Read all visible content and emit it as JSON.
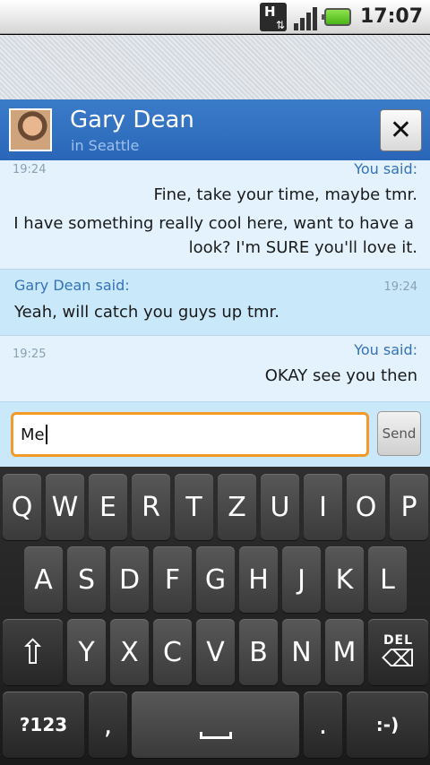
{
  "status_bar": {
    "network_type": "H",
    "network_arrows": "⇅",
    "time": "17:07"
  },
  "header": {
    "contact_name": "Gary Dean",
    "location": "in Seattle",
    "close_glyph": "✕"
  },
  "messages": [
    {
      "time": "19:24",
      "sender": "You said:",
      "lines": [
        "Fine, take your time, maybe tmr.",
        "I have something really cool here, want to have a",
        "look? I'm SURE you'll love it."
      ]
    },
    {
      "time": "19:24",
      "sender": "Gary Dean said:",
      "lines": [
        "Yeah, will catch you guys up tmr."
      ]
    },
    {
      "time": "19:25",
      "sender": "You said:",
      "lines": [
        "OKAY see you then"
      ]
    }
  ],
  "compose": {
    "input_value": "Me",
    "send_label": "Send"
  },
  "keyboard": {
    "row1": [
      "Q",
      "W",
      "E",
      "R",
      "T",
      "Z",
      "U",
      "I",
      "O",
      "P"
    ],
    "row2": [
      "A",
      "S",
      "D",
      "F",
      "G",
      "H",
      "J",
      "K",
      "L"
    ],
    "row3": [
      "Y",
      "X",
      "C",
      "V",
      "B",
      "N",
      "M"
    ],
    "shift_glyph": "⇧",
    "del_label": "DEL",
    "del_glyph": "⌫",
    "symbols_label": "?123",
    "comma": ",",
    "period": ".",
    "smiley": ":-)"
  },
  "icons": {
    "network": "network-h-icon",
    "signal": "signal-icon",
    "battery": "battery-icon",
    "close": "close-icon",
    "shift": "shift-icon",
    "delete": "backspace-icon",
    "space": "space-icon"
  },
  "colors": {
    "header": "#2a66b8",
    "outgoing_bg": "#e3f2fc",
    "incoming_bg": "#c9e8fa",
    "input_focus": "#f39a2a",
    "sender_text": "#3472b9"
  }
}
